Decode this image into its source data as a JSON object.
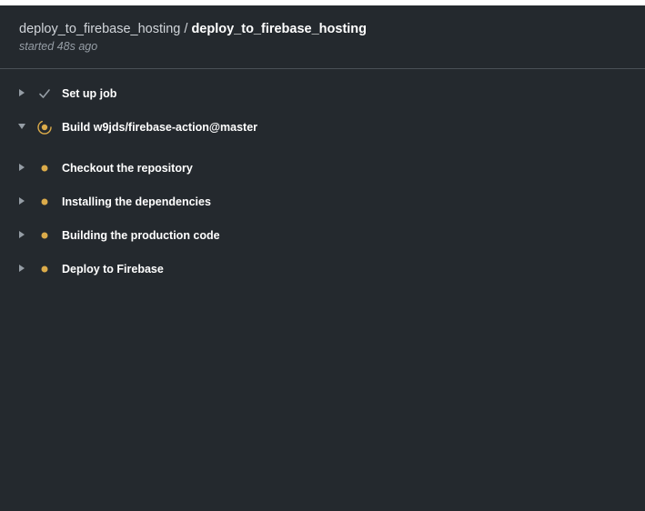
{
  "header": {
    "workflow_name": "deploy_to_firebase_hosting",
    "separator": " / ",
    "job_name": "deploy_to_firebase_hosting",
    "started": "started 48s ago"
  },
  "colors": {
    "background": "#24292e",
    "success": "#959da5",
    "in_progress": "#dbab4a",
    "queued": "#dbab4a"
  },
  "steps": [
    {
      "label": "Set up job",
      "status": "success",
      "icon": "check-icon",
      "expanded": false
    },
    {
      "label": "Build w9jds/firebase-action@master",
      "status": "in_progress",
      "icon": "spinner-icon",
      "expanded": true
    },
    {
      "label": "Checkout the repository",
      "status": "queued",
      "icon": "dot-icon",
      "expanded": false
    },
    {
      "label": "Installing the dependencies",
      "status": "queued",
      "icon": "dot-icon",
      "expanded": false
    },
    {
      "label": "Building the production code",
      "status": "queued",
      "icon": "dot-icon",
      "expanded": false
    },
    {
      "label": "Deploy to Firebase",
      "status": "queued",
      "icon": "dot-icon",
      "expanded": false
    }
  ]
}
